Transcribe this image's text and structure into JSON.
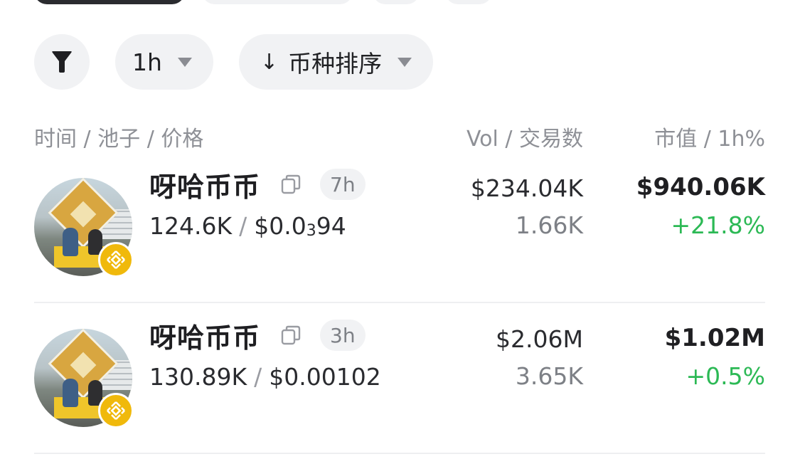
{
  "filters": {
    "timeframe": "1h",
    "sort_label": "币种排序",
    "sort_arrow": "↓"
  },
  "columns": {
    "left": "时间 / 池子 / 价格",
    "mid": "Vol / 交易数",
    "right": "市值 / 1h%"
  },
  "rows": [
    {
      "name": "呀哈币币",
      "age": "7h",
      "liquidity": "124.6K",
      "price_prefix": "$0.0",
      "price_sub": "3",
      "price_suffix": "94",
      "volume": "$234.04K",
      "trades": "1.66K",
      "market_cap": "$940.06K",
      "change": "+21.8%"
    },
    {
      "name": "呀哈币币",
      "age": "3h",
      "liquidity": "130.89K",
      "price_prefix": "$0.00102",
      "price_sub": "",
      "price_suffix": "",
      "volume": "$2.06M",
      "trades": "3.65K",
      "market_cap": "$1.02M",
      "change": "+0.5%"
    }
  ],
  "colors": {
    "positive": "#2cb955",
    "pill_bg": "#f1f2f4",
    "chain_badge": "#f0b90b"
  },
  "icons": {
    "filter": "filter-funnel-icon",
    "copy": "copy-icon",
    "chain": "bnb-chain-icon"
  }
}
